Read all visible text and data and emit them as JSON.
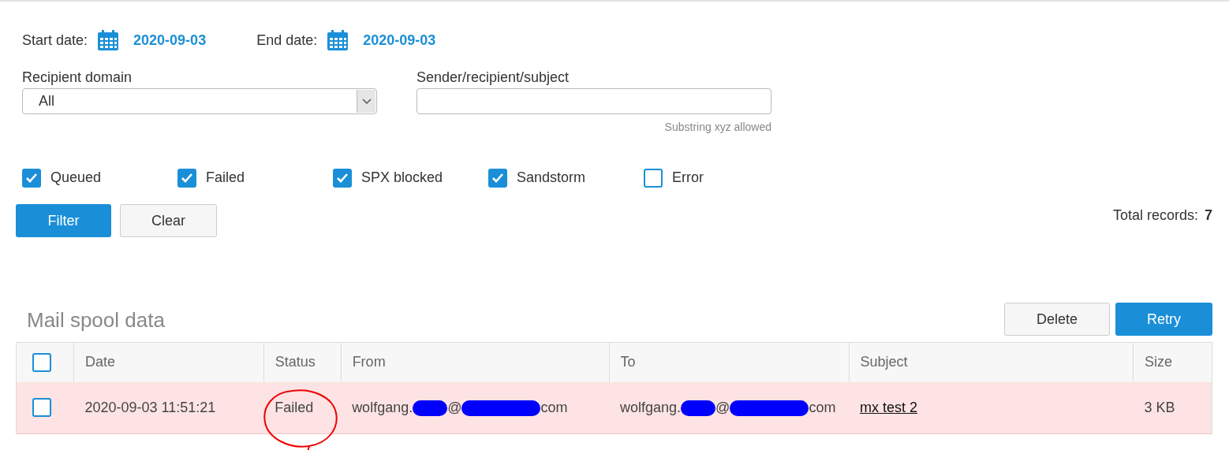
{
  "dates": [
    {
      "label": "Start date:",
      "value": "2020-09-03"
    },
    {
      "label": "End date:",
      "value": "2020-09-03"
    }
  ],
  "recipient_domain": {
    "label": "Recipient domain",
    "value": "All"
  },
  "search": {
    "label": "Sender/recipient/subject",
    "hint": "Substring xyz allowed"
  },
  "status_filters": [
    {
      "label": "Queued",
      "checked": true
    },
    {
      "label": "Failed",
      "checked": true
    },
    {
      "label": "SPX blocked",
      "checked": true
    },
    {
      "label": "Sandstorm",
      "checked": true
    },
    {
      "label": "Error",
      "checked": false
    }
  ],
  "buttons": {
    "filter": "Filter",
    "clear": "Clear"
  },
  "total_records": {
    "label": "Total records:",
    "value": "7"
  },
  "section_title": "Mail spool data",
  "actions": {
    "delete": "Delete",
    "retry": "Retry"
  },
  "table": {
    "header_checked": false,
    "columns": [
      "Date",
      "Status",
      "From",
      "To",
      "Subject",
      "Size"
    ],
    "rows": [
      {
        "checked": false,
        "failed": true,
        "date": "2020-09-03 11:51:21",
        "status": "Failed",
        "status_circled": true,
        "from": [
          {
            "kind": "text",
            "text": "wolfgang."
          },
          {
            "kind": "redaction"
          },
          {
            "kind": "text",
            "text": "@"
          },
          {
            "kind": "redaction"
          },
          {
            "kind": "text",
            "text": "com"
          }
        ],
        "to": [
          {
            "kind": "text",
            "text": "wolfgang."
          },
          {
            "kind": "redaction"
          },
          {
            "kind": "text",
            "text": "@"
          },
          {
            "kind": "redaction"
          },
          {
            "kind": "text",
            "text": "com"
          }
        ],
        "subject": "mx test 2",
        "size": "3 KB"
      }
    ]
  }
}
